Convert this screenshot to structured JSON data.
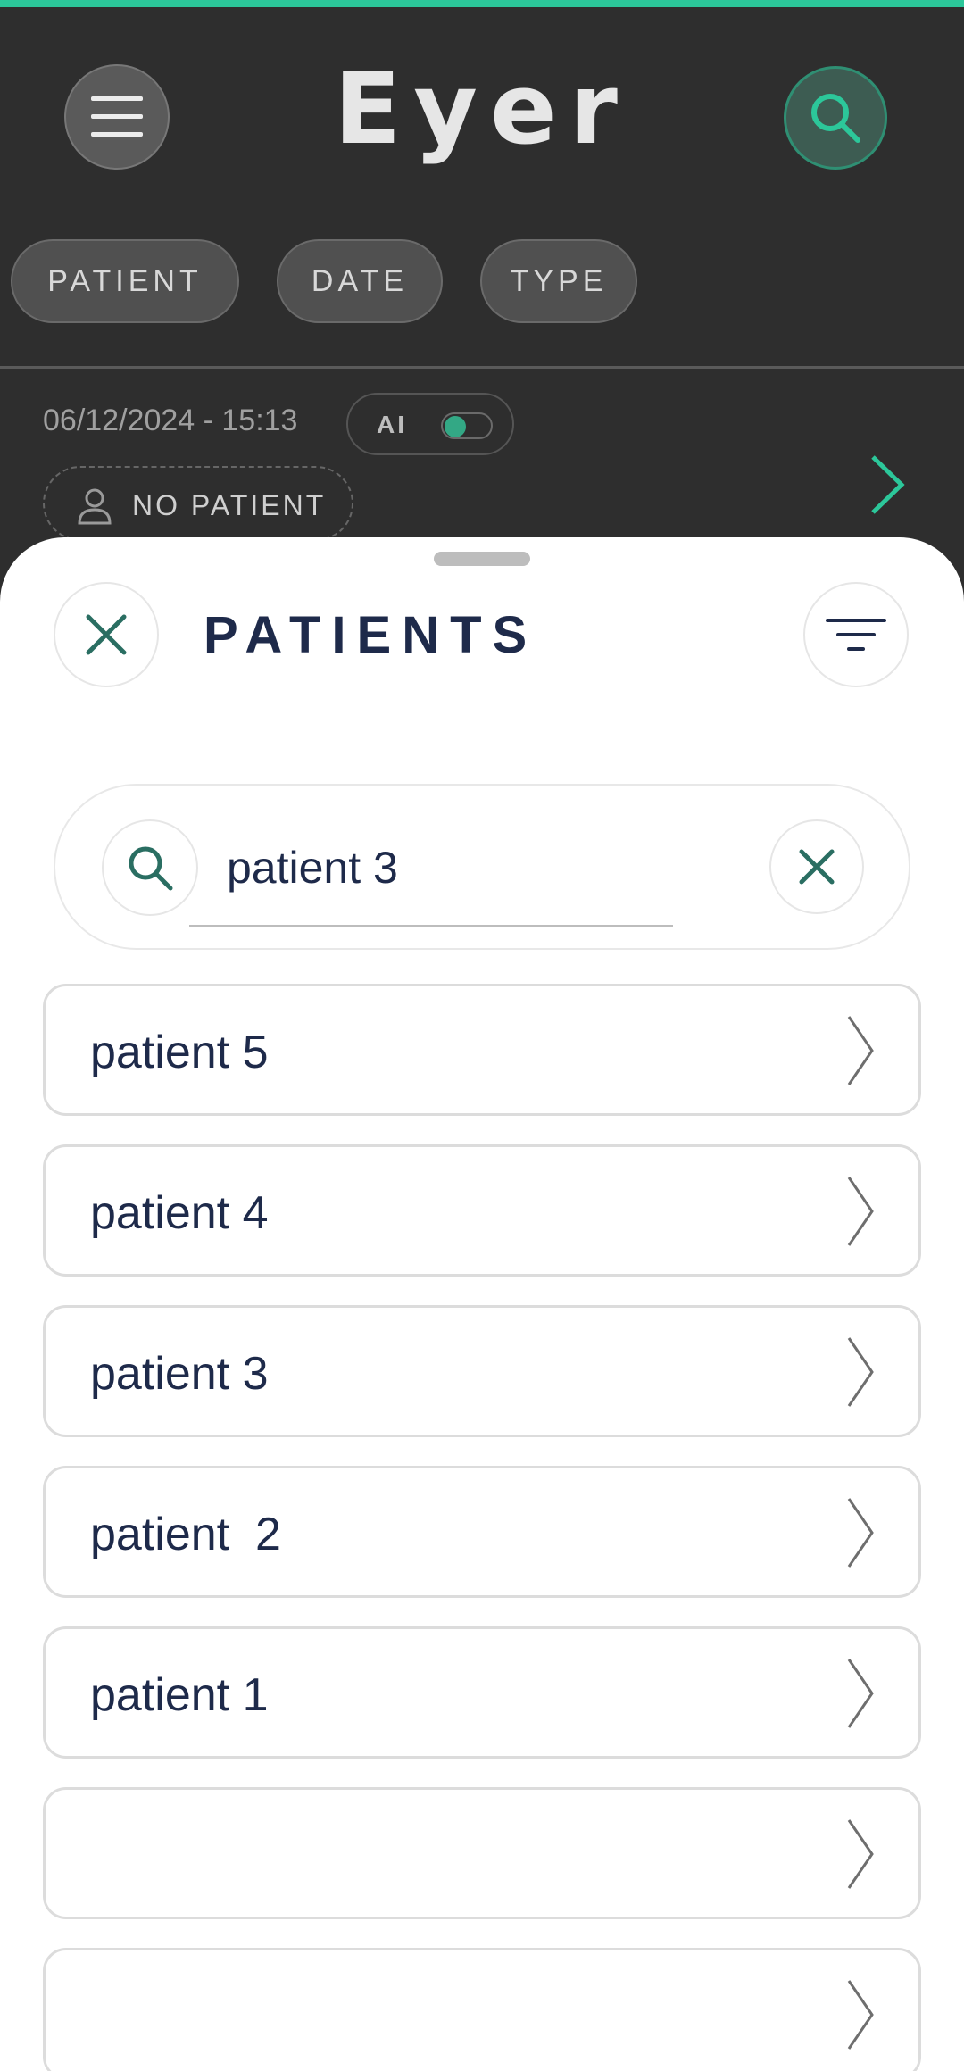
{
  "app": {
    "logo": "Eyer"
  },
  "filters": {
    "patient": "PATIENT",
    "date": "DATE",
    "type": "TYPE"
  },
  "exam": {
    "datetime": "06/12/2024 - 15:13",
    "ai_label": "AI",
    "ai_enabled": true,
    "patient_status": "NO PATIENT"
  },
  "sheet": {
    "title": "PATIENTS"
  },
  "search": {
    "value": "patient 3"
  },
  "patients": [
    {
      "name": "patient 5"
    },
    {
      "name": "patient 4"
    },
    {
      "name": "patient 3"
    },
    {
      "name": "patient  2"
    },
    {
      "name": "patient 1"
    },
    {
      "name": ""
    },
    {
      "name": ""
    }
  ],
  "colors": {
    "accent": "#2cc79a",
    "title": "#1e2a4a",
    "dark_bg": "#2e2e2e",
    "icon_teal": "#2a6e62"
  },
  "icons": [
    "menu-icon",
    "search-icon",
    "chevron-right-icon",
    "person-icon",
    "close-icon",
    "filter-icon"
  ]
}
